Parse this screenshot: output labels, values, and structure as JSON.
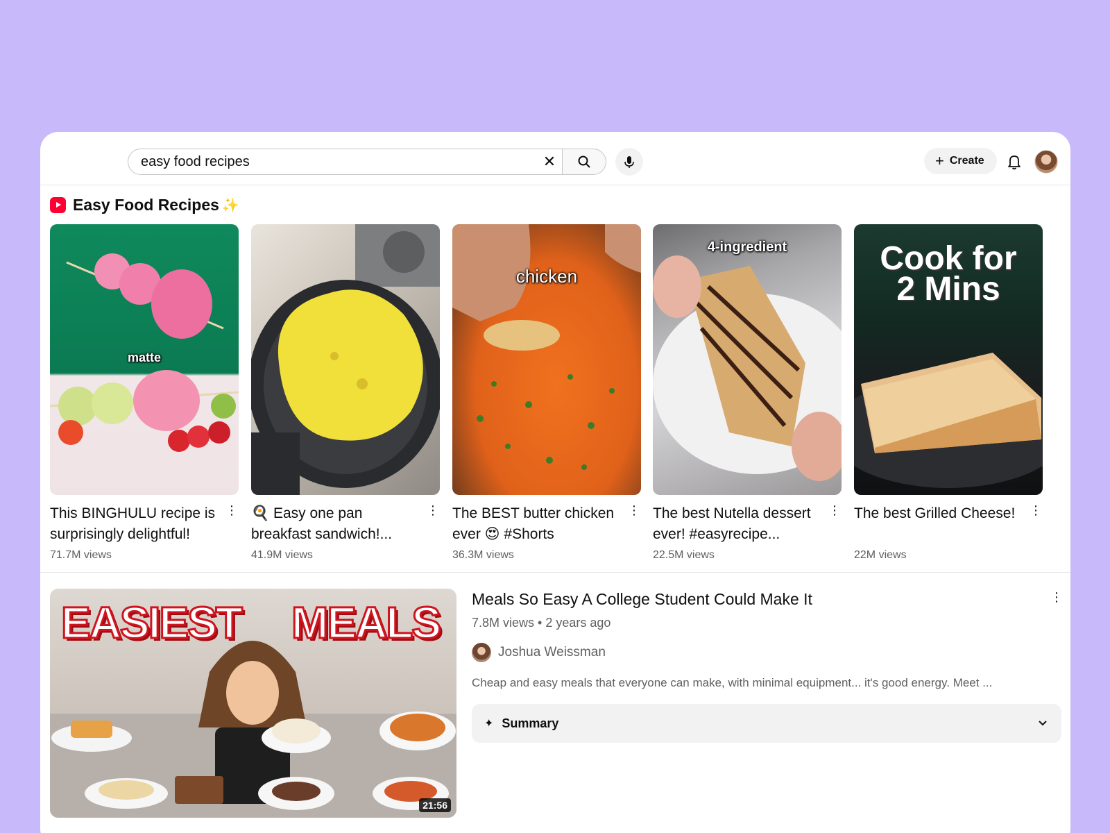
{
  "search": {
    "value": "easy food recipes",
    "clear_icon": "close-icon",
    "search_icon": "search-icon",
    "mic_icon": "microphone-icon"
  },
  "header": {
    "create_label": "Create",
    "create_icon": "plus-icon",
    "notifications_icon": "bell-icon"
  },
  "shorts": {
    "section_title": "Easy Food Recipes",
    "sparkle": "✨",
    "items": [
      {
        "title": "This BINGHULU recipe is surprisingly delightful!",
        "views": "71.7M views",
        "overlay": "matte"
      },
      {
        "title": "🍳 Easy one pan breakfast sandwich!...",
        "views": "41.9M views",
        "overlay": ""
      },
      {
        "title": "The BEST butter chicken ever 😍 #Shorts",
        "views": "36.3M views",
        "overlay": "chicken"
      },
      {
        "title": "The best Nutella dessert ever! #easyrecipe...",
        "views": "22.5M views",
        "overlay": "4-ingredient"
      },
      {
        "title": "The best Grilled Cheese!",
        "views": "22M views",
        "overlay": "Cook for 2 Mins"
      }
    ]
  },
  "video": {
    "title": "Meals So Easy A College Student Could Make It",
    "meta": "7.8M views • 2 years ago",
    "channel": "Joshua Weissman",
    "description": "Cheap and easy meals that everyone can make, with minimal equipment... it's good energy. Meet ...",
    "duration": "21:56",
    "thumb_left": "EASIEST",
    "thumb_right": "MEALS",
    "summary_label": "Summary"
  },
  "colors": {
    "background": "#c8b9fb",
    "shorts_red": "#ff0033",
    "secondary_text": "#606060"
  }
}
